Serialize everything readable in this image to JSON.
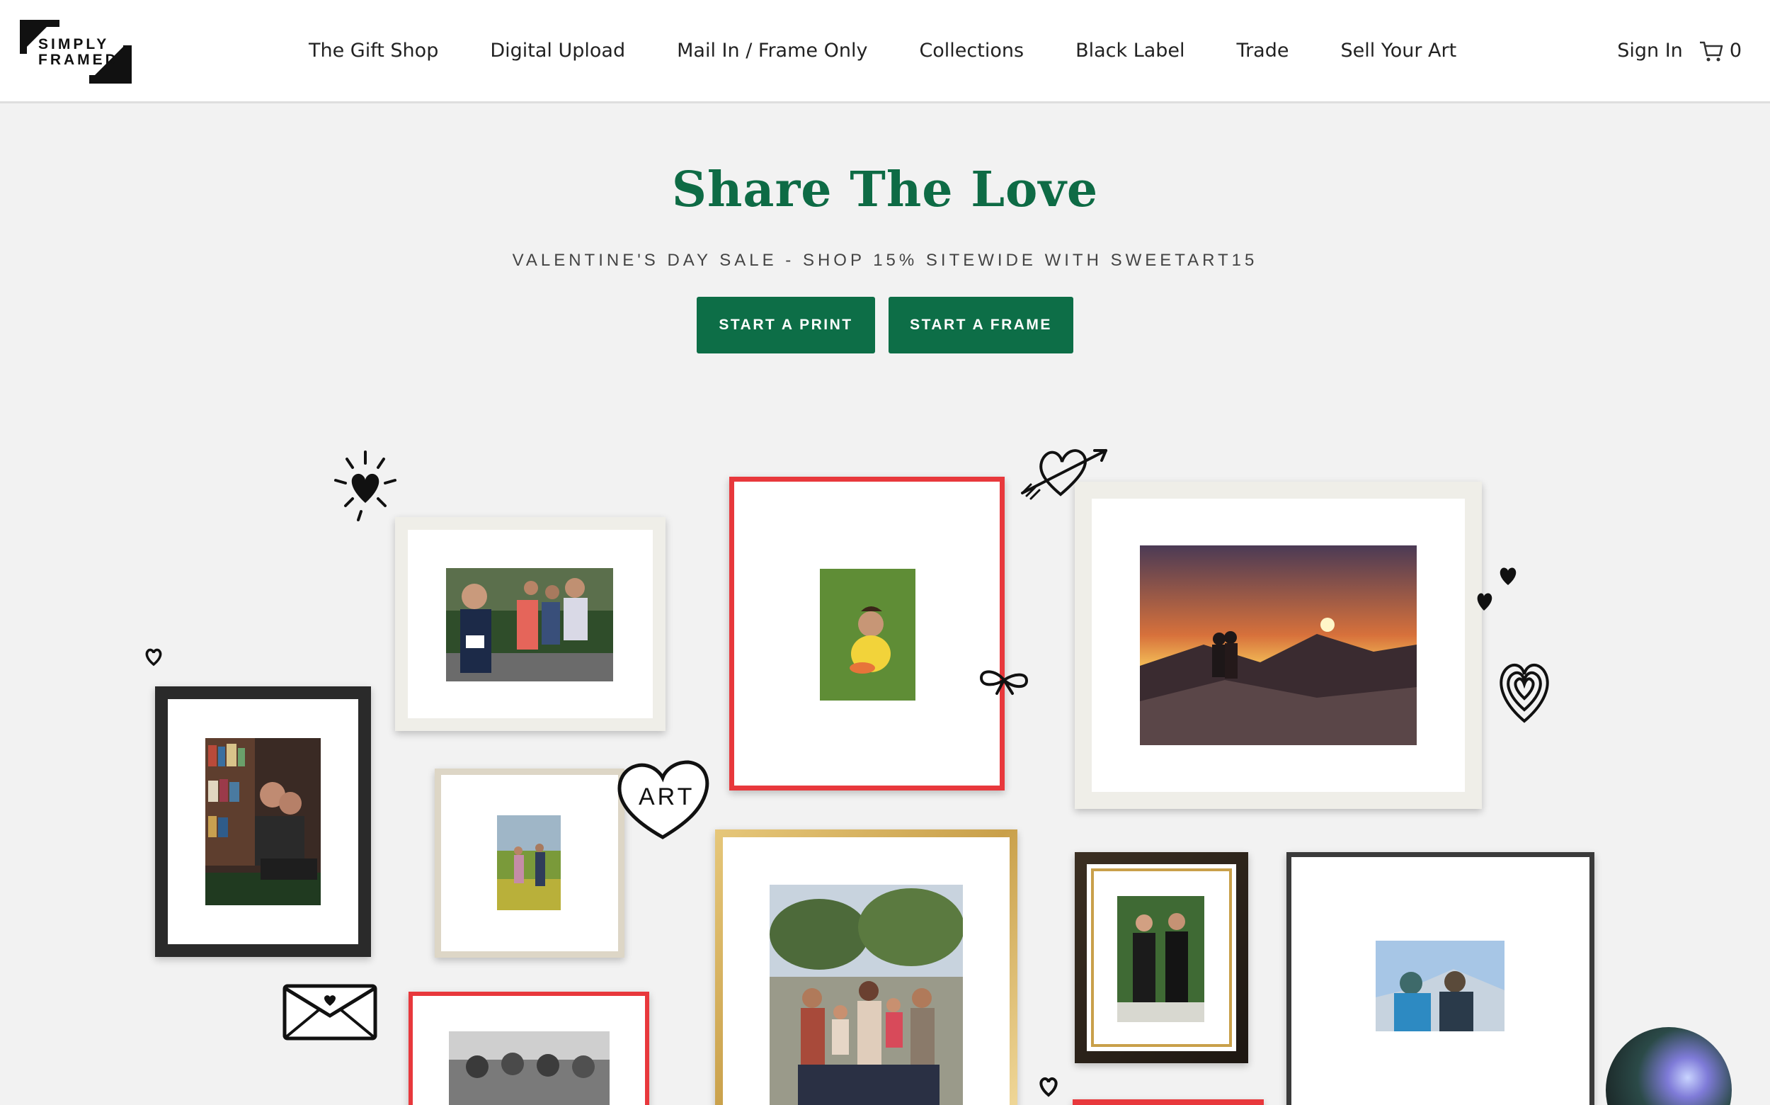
{
  "header": {
    "logo": {
      "line1": "SIMPLY",
      "line2": "FRAMED"
    },
    "nav": [
      {
        "label": "The Gift Shop"
      },
      {
        "label": "Digital Upload"
      },
      {
        "label": "Mail In / Frame Only"
      },
      {
        "label": "Collections"
      },
      {
        "label": "Black Label"
      },
      {
        "label": "Trade"
      },
      {
        "label": "Sell Your Art"
      }
    ],
    "sign_in": "Sign In",
    "cart_count": "0",
    "cart_icon": "cart-icon"
  },
  "hero": {
    "title": "Share The Love",
    "subtitle": "VALENTINE'S DAY SALE - SHOP 15% SITEWIDE WITH SWEETART15",
    "primary_button": "START A PRINT",
    "secondary_button": "START A FRAME"
  },
  "doodles": {
    "heart_badge_text": "ART"
  },
  "colors": {
    "brand_green": "#0d6e47",
    "title_green": "#0e6b45",
    "background": "#f2f2f2"
  }
}
